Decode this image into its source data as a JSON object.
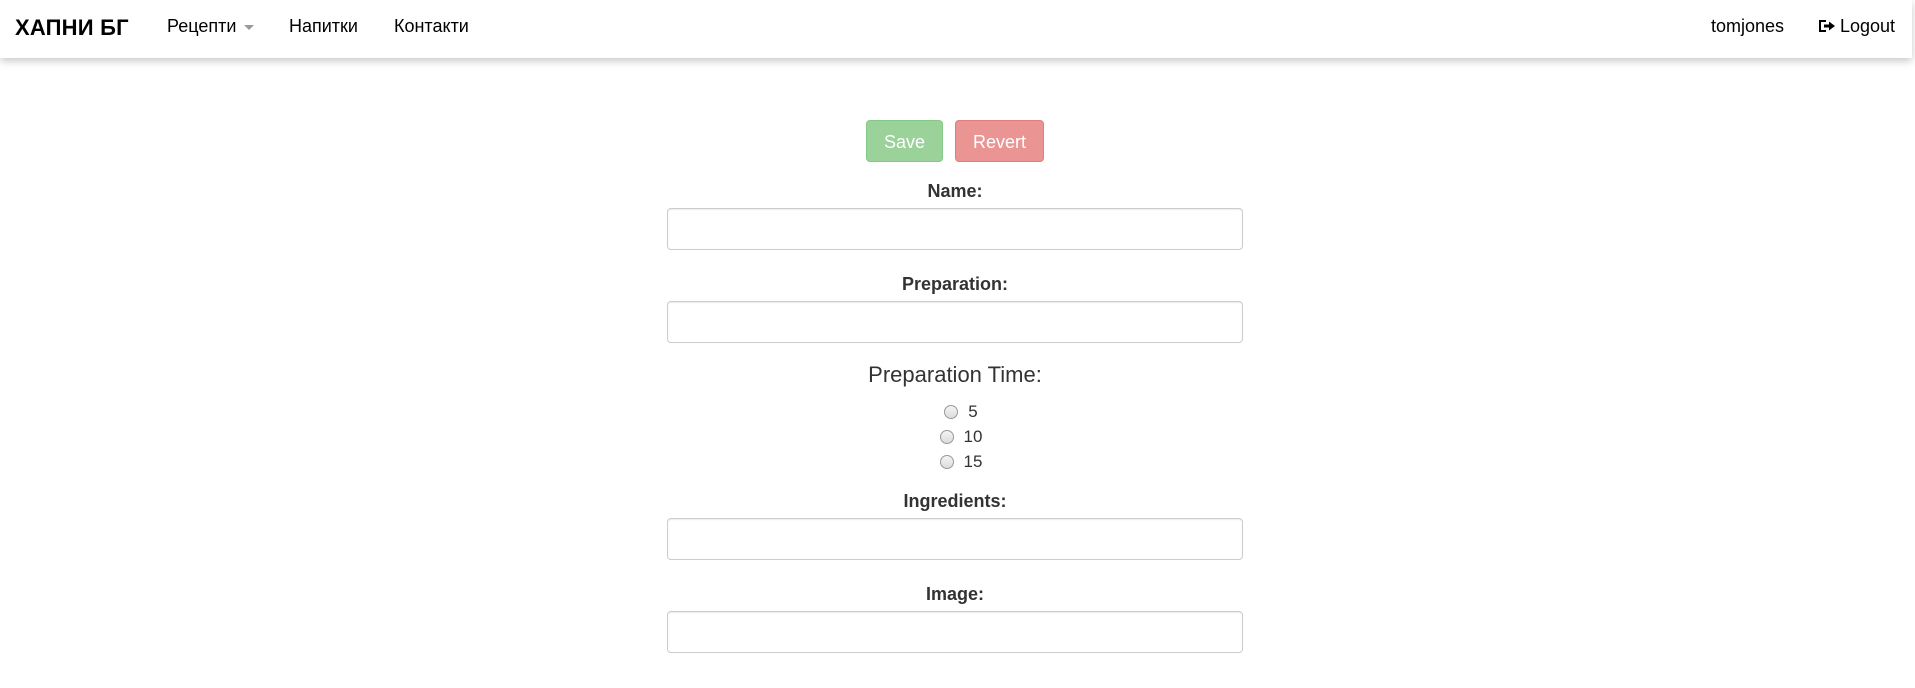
{
  "navbar": {
    "brand": "ХАПНИ БГ",
    "items": [
      {
        "label": "Рецепти",
        "has_dropdown": true
      },
      {
        "label": "Напитки"
      },
      {
        "label": "Контакти"
      }
    ],
    "user": "tomjones",
    "logout": "Logout"
  },
  "form": {
    "save_label": "Save",
    "revert_label": "Revert",
    "name_label": "Name:",
    "name_value": "",
    "preparation_label": "Preparation:",
    "preparation_value": "",
    "prep_time_label": "Preparation Time:",
    "prep_time_options": [
      "5",
      "10",
      "15"
    ],
    "ingredients_label": "Ingredients:",
    "ingredients_value": "",
    "image_label": "Image:",
    "image_value": ""
  },
  "colors": {
    "save": "#9ad29a",
    "revert": "#ea9494"
  }
}
